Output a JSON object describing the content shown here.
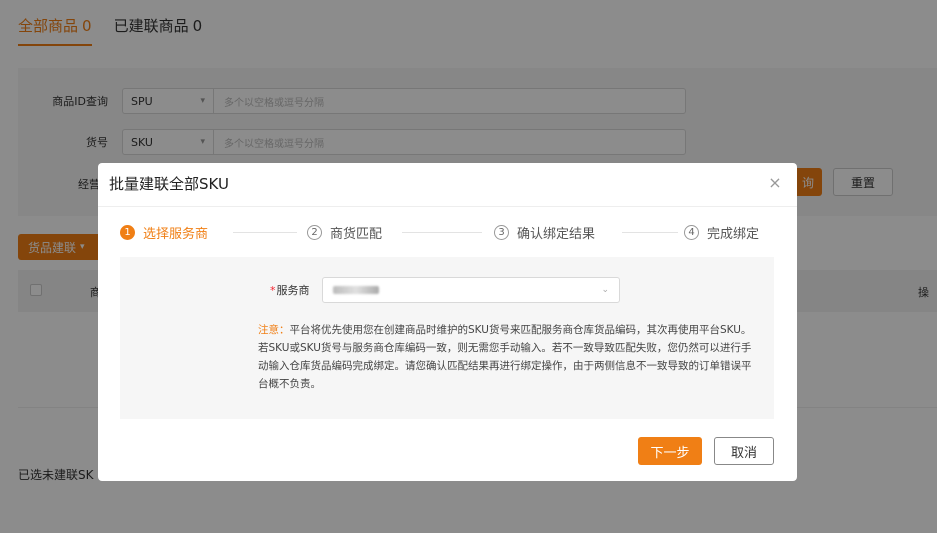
{
  "tabs": [
    {
      "label": "全部商品",
      "count": "0"
    },
    {
      "label": "已建联商品",
      "count": "0"
    }
  ],
  "filters": {
    "spu_label": "商品ID查询",
    "spu_select": "SPU",
    "spu_placeholder": "多个以空格或逗号分隔",
    "sku_label": "货号",
    "sku_select": "SKU",
    "sku_placeholder": "多个以空格或逗号分隔",
    "business_label": "经营",
    "query_button": "询",
    "reset_button": "重置"
  },
  "toolbar": {
    "link_button": "货品建联"
  },
  "table": {
    "first_col": "商",
    "last_col": "操"
  },
  "footer": {
    "selected_text": "已选未建联SK"
  },
  "modal": {
    "title": "批量建联全部SKU",
    "close_icon": "×",
    "steps": [
      {
        "num": "1",
        "label": "选择服务商"
      },
      {
        "num": "2",
        "label": "商货匹配"
      },
      {
        "num": "3",
        "label": "确认绑定结果"
      },
      {
        "num": "4",
        "label": "完成绑定"
      }
    ],
    "provider_label": "服务商",
    "provider_required": "*",
    "note_prefix": "注意：",
    "note_text": "平台将优先使用您在创建商品时维护的SKU货号来匹配服务商仓库货品编码，其次再使用平台SKU。若SKU或SKU货号与服务商仓库编码一致，则无需您手动输入。若不一致导致匹配失败，您仍然可以进行手动输入仓库货品编码完成绑定。请您确认匹配结果再进行绑定操作，由于两侧信息不一致导致的订单错误平台概不负责。",
    "next_button": "下一步",
    "cancel_button": "取消"
  },
  "colors": {
    "accent": "#f07f15"
  }
}
